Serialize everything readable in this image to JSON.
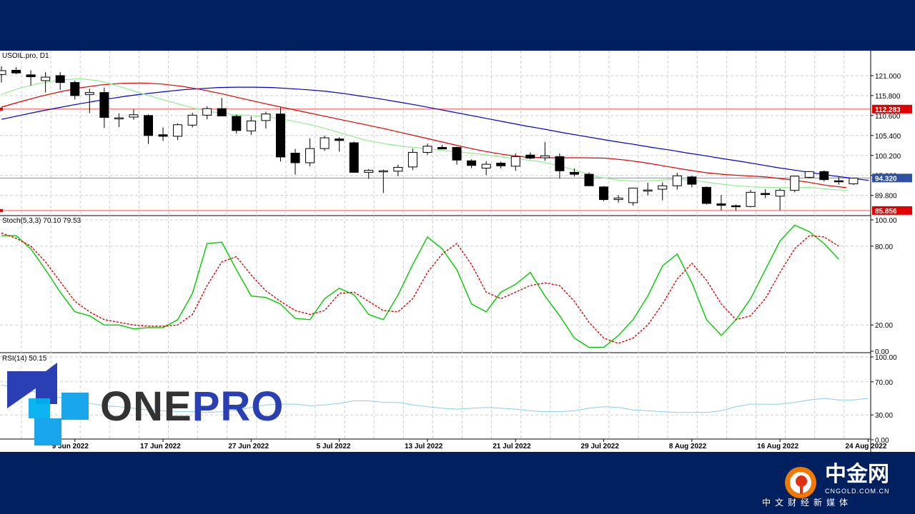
{
  "chart_data": [
    {
      "type": "candlestick",
      "title": "USOIL.pro, D1",
      "y_ticks": [
        "121.000",
        "115.800",
        "110.600",
        "105.400",
        "100.200",
        "95.000",
        "89.800"
      ],
      "ylim": [
        84.9,
        127.5
      ],
      "x_date_labels": [
        "9 Jun 2022",
        "17 Jun 2022",
        "27 Jun 2022",
        "5 Jul 2022",
        "13 Jul 2022",
        "21 Jul 2022",
        "29 Jul 2022",
        "8 Aug 2022",
        "16 Aug 2022",
        "24 Aug 2022"
      ],
      "x_date_label_index": [
        5,
        11,
        17,
        23,
        29,
        35,
        41,
        47,
        53,
        59
      ],
      "price_tags": [
        {
          "label": "112.283",
          "value": 112.283,
          "color": "#e00000",
          "type": "horizontal-line"
        },
        {
          "label": "94.320",
          "value": 94.32,
          "color": "#3050a0",
          "type": "current-price"
        },
        {
          "label": "85.856",
          "value": 85.856,
          "color": "#e00000",
          "type": "horizontal-line"
        }
      ],
      "candles": [
        {
          "o": 121.3,
          "h": 123.4,
          "l": 119.2,
          "c": 122.3
        },
        {
          "o": 122.4,
          "h": 123.2,
          "l": 121.4,
          "c": 121.7
        },
        {
          "o": 121.2,
          "h": 122.4,
          "l": 118.4,
          "c": 120.7
        },
        {
          "o": 119.7,
          "h": 121.9,
          "l": 116.6,
          "c": 120.6
        },
        {
          "o": 121.0,
          "h": 121.9,
          "l": 117.3,
          "c": 119.2
        },
        {
          "o": 119.2,
          "h": 119.7,
          "l": 114.8,
          "c": 115.8
        },
        {
          "o": 116.1,
          "h": 117.6,
          "l": 111.2,
          "c": 116.6
        },
        {
          "o": 116.6,
          "h": 117.9,
          "l": 107.4,
          "c": 110.1
        },
        {
          "o": 110.0,
          "h": 111.2,
          "l": 107.6,
          "c": 110.0
        },
        {
          "o": 110.2,
          "h": 112.2,
          "l": 109.5,
          "c": 110.8
        },
        {
          "o": 110.6,
          "h": 110.9,
          "l": 103.2,
          "c": 105.4
        },
        {
          "o": 105.6,
          "h": 107.5,
          "l": 104.0,
          "c": 105.2
        },
        {
          "o": 105.2,
          "h": 108.6,
          "l": 104.2,
          "c": 108.2
        },
        {
          "o": 108.1,
          "h": 111.3,
          "l": 107.5,
          "c": 110.7
        },
        {
          "o": 110.7,
          "h": 113.0,
          "l": 109.6,
          "c": 112.4
        },
        {
          "o": 112.4,
          "h": 115.2,
          "l": 110.7,
          "c": 110.5
        },
        {
          "o": 110.4,
          "h": 110.8,
          "l": 105.9,
          "c": 106.7
        },
        {
          "o": 106.6,
          "h": 110.4,
          "l": 105.6,
          "c": 109.2
        },
        {
          "o": 109.3,
          "h": 111.6,
          "l": 107.2,
          "c": 111.0
        },
        {
          "o": 111.0,
          "h": 112.7,
          "l": 98.6,
          "c": 99.8
        },
        {
          "o": 100.8,
          "h": 101.9,
          "l": 95.2,
          "c": 98.3
        },
        {
          "o": 98.3,
          "h": 104.6,
          "l": 97.4,
          "c": 102.0
        },
        {
          "o": 102.0,
          "h": 105.4,
          "l": 101.4,
          "c": 104.8
        },
        {
          "o": 104.5,
          "h": 105.0,
          "l": 101.2,
          "c": 104.1
        },
        {
          "o": 103.5,
          "h": 103.8,
          "l": 95.8,
          "c": 95.8
        },
        {
          "o": 95.8,
          "h": 96.6,
          "l": 94.1,
          "c": 96.3
        },
        {
          "o": 96.1,
          "h": 96.5,
          "l": 90.4,
          "c": 96.2
        },
        {
          "o": 96.1,
          "h": 97.8,
          "l": 94.8,
          "c": 97.1
        },
        {
          "o": 97.2,
          "h": 102.0,
          "l": 96.4,
          "c": 101.0
        },
        {
          "o": 101.0,
          "h": 103.3,
          "l": 100.4,
          "c": 102.6
        },
        {
          "o": 102.3,
          "h": 102.9,
          "l": 101.9,
          "c": 101.9
        },
        {
          "o": 102.3,
          "h": 102.5,
          "l": 97.8,
          "c": 99.0
        },
        {
          "o": 98.8,
          "h": 99.2,
          "l": 96.9,
          "c": 97.6
        },
        {
          "o": 96.9,
          "h": 98.7,
          "l": 95.1,
          "c": 97.9
        },
        {
          "o": 98.2,
          "h": 98.6,
          "l": 96.8,
          "c": 97.5
        },
        {
          "o": 97.4,
          "h": 100.7,
          "l": 96.2,
          "c": 99.9
        },
        {
          "o": 100.3,
          "h": 101.0,
          "l": 99.2,
          "c": 99.5
        },
        {
          "o": 99.6,
          "h": 103.7,
          "l": 98.8,
          "c": 100.1
        },
        {
          "o": 99.9,
          "h": 100.7,
          "l": 94.2,
          "c": 96.2
        },
        {
          "o": 95.8,
          "h": 96.8,
          "l": 94.7,
          "c": 95.3
        },
        {
          "o": 95.3,
          "h": 95.8,
          "l": 92.2,
          "c": 92.3
        },
        {
          "o": 92.0,
          "h": 92.2,
          "l": 88.3,
          "c": 88.7
        },
        {
          "o": 88.7,
          "h": 89.9,
          "l": 87.9,
          "c": 89.1
        },
        {
          "o": 87.9,
          "h": 91.7,
          "l": 87.1,
          "c": 91.7
        },
        {
          "o": 91.2,
          "h": 93.1,
          "l": 89.8,
          "c": 91.2
        },
        {
          "o": 91.4,
          "h": 93.2,
          "l": 88.5,
          "c": 92.3
        },
        {
          "o": 92.3,
          "h": 95.7,
          "l": 91.3,
          "c": 94.9
        },
        {
          "o": 94.6,
          "h": 94.9,
          "l": 91.9,
          "c": 92.7
        },
        {
          "o": 91.9,
          "h": 92.1,
          "l": 87.4,
          "c": 87.7
        },
        {
          "o": 87.6,
          "h": 89.9,
          "l": 85.9,
          "c": 87.2
        },
        {
          "o": 87.1,
          "h": 87.4,
          "l": 85.8,
          "c": 86.9
        },
        {
          "o": 86.9,
          "h": 91.2,
          "l": 86.7,
          "c": 90.6
        },
        {
          "o": 90.3,
          "h": 91.4,
          "l": 89.1,
          "c": 90.1
        },
        {
          "o": 89.6,
          "h": 91.6,
          "l": 85.9,
          "c": 91.1
        },
        {
          "o": 91.1,
          "h": 95.0,
          "l": 90.6,
          "c": 94.8
        },
        {
          "o": 94.5,
          "h": 96.1,
          "l": 94.2,
          "c": 96.0
        },
        {
          "o": 96.0,
          "h": 96.3,
          "l": 93.4,
          "c": 93.9
        },
        {
          "o": 93.6,
          "h": 94.6,
          "l": 92.6,
          "c": 93.5
        },
        {
          "o": 92.8,
          "h": 94.4,
          "l": 92.5,
          "c": 94.3
        }
      ],
      "series": [
        {
          "color": "#0000cc",
          "values": [
            109.6,
            110.6,
            111.6,
            112.5,
            113.4,
            114.2,
            115.0,
            115.7,
            116.3,
            116.8,
            117.3,
            117.6,
            117.9,
            118.0,
            118.0,
            117.9,
            117.6,
            117.3,
            116.9,
            116.3,
            115.6,
            114.9,
            114.1,
            113.3,
            112.4,
            111.5,
            110.6,
            109.7,
            108.8,
            107.9,
            107.1,
            106.2,
            105.4,
            104.6,
            103.8,
            103.1,
            102.3,
            101.6,
            100.8,
            100.1,
            99.3,
            98.6,
            97.8,
            97.0,
            96.3,
            95.6,
            94.9,
            94.3,
            93.7
          ]
        },
        {
          "color": "#e00000",
          "values": [
            112.8,
            114.3,
            115.7,
            116.9,
            117.9,
            118.6,
            119.0,
            119.1,
            118.8,
            118.2,
            117.3,
            116.2,
            115.0,
            113.8,
            112.7,
            111.6,
            110.5,
            109.4,
            108.3,
            107.2,
            106.0,
            104.8,
            103.6,
            102.4,
            101.3,
            100.4,
            99.8,
            99.6,
            99.6,
            99.6,
            99.5,
            99.0,
            98.3,
            97.4,
            96.5,
            95.7,
            95.2,
            94.9,
            94.6,
            94.0,
            93.3,
            92.4,
            91.8
          ]
        },
        {
          "color": "#90ee90",
          "values": [
            116.1,
            117.8,
            119.0,
            119.8,
            120.2,
            119.7,
            118.4,
            116.8,
            115.3,
            113.9,
            112.5,
            111.5,
            110.9,
            110.6,
            110.1,
            109.3,
            108.3,
            107.0,
            105.5,
            104.1,
            103.2,
            102.5,
            102.0,
            101.5,
            101.0,
            100.5,
            99.8,
            99.2,
            98.6,
            97.5,
            96.1,
            94.6,
            93.8,
            93.5,
            93.7,
            94.0,
            93.7,
            93.0,
            92.4,
            92.0,
            91.9,
            91.8,
            91.9,
            91.4,
            91.1
          ]
        }
      ],
      "series_x_start_index": [
        0,
        0,
        0
      ],
      "series_x_step": [
        1.23,
        1.37,
        1.31
      ]
    },
    {
      "type": "line",
      "title": "Stoch(5,3,3) 70.10 79.53",
      "y_ticks": [
        "100.00",
        "80.00",
        "20.00",
        "0.00"
      ],
      "ylim": [
        0,
        100
      ],
      "series": [
        {
          "color": "#00cc00",
          "style": "solid",
          "values": [
            88,
            88,
            78,
            62,
            45,
            30,
            27,
            20,
            20,
            17,
            18,
            18,
            24,
            44,
            82,
            83,
            62,
            42,
            41,
            36,
            25,
            24,
            40,
            48,
            43,
            28,
            24,
            43,
            66,
            87,
            78,
            62,
            36,
            30,
            45,
            51,
            60,
            42,
            27,
            10,
            3,
            3,
            12,
            24,
            42,
            65,
            74,
            52,
            24,
            12,
            24,
            40,
            62,
            84,
            96,
            91,
            82,
            70
          ]
        },
        {
          "color": "#e00000",
          "style": "dotted",
          "values": [
            90,
            86,
            80,
            68,
            53,
            38,
            30,
            24,
            22,
            20,
            19,
            19,
            20,
            28,
            50,
            68,
            72,
            58,
            46,
            38,
            31,
            28,
            31,
            44,
            45,
            38,
            31,
            30,
            40,
            60,
            74,
            82,
            66,
            45,
            40,
            45,
            50,
            52,
            50,
            38,
            22,
            10,
            6,
            10,
            20,
            36,
            55,
            67,
            54,
            36,
            24,
            27,
            40,
            60,
            78,
            88,
            87,
            80
          ]
        }
      ]
    },
    {
      "type": "line",
      "title": "RSI(14) 50.15",
      "y_ticks": [
        "100.00",
        "70.00",
        "30.00",
        "0.00"
      ],
      "ylim": [
        0,
        100
      ],
      "series": [
        {
          "color": "#87ceeb",
          "values": [
            66,
            63,
            59,
            55,
            51,
            45,
            44,
            41,
            40,
            38,
            36,
            35,
            34,
            34,
            33,
            34,
            36,
            39,
            42,
            43,
            43,
            41,
            42,
            44,
            47,
            47,
            45,
            45,
            42,
            40,
            38,
            37,
            38,
            39,
            38,
            37,
            35,
            34,
            34,
            35,
            38,
            40,
            39,
            36,
            35,
            34,
            33,
            33,
            33,
            35,
            40,
            43,
            43,
            43,
            45,
            48,
            50,
            48,
            48,
            50
          ]
        }
      ]
    }
  ],
  "branding": {
    "one": "ONE",
    "pro": "PRO",
    "cngold_name": "中金网",
    "cngold_domain": "CNGOLD.COM.CN",
    "cngold_tagline": "中文财经新媒体"
  }
}
